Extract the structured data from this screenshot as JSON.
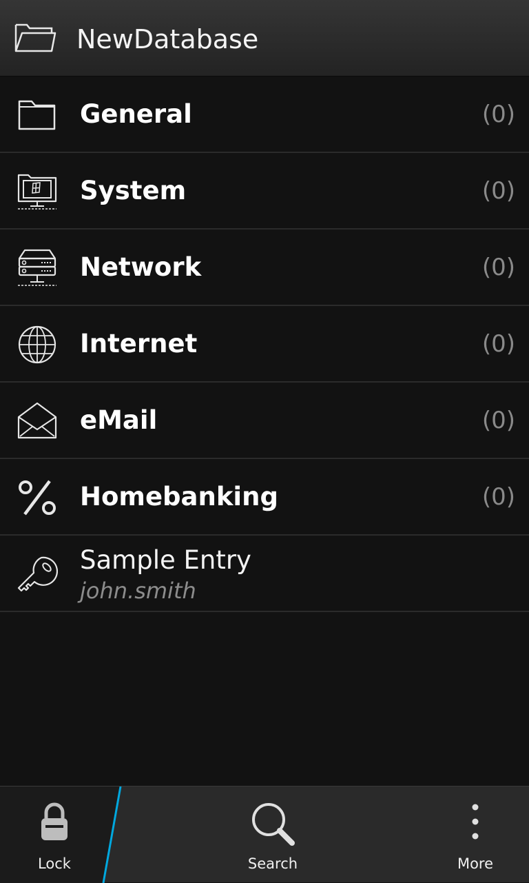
{
  "header": {
    "title": "NewDatabase",
    "icon": "folder-open-icon"
  },
  "groups": [
    {
      "label": "General",
      "count": "(0)",
      "icon": "folder-icon"
    },
    {
      "label": "System",
      "count": "(0)",
      "icon": "computer-icon"
    },
    {
      "label": "Network",
      "count": "(0)",
      "icon": "server-icon"
    },
    {
      "label": "Internet",
      "count": "(0)",
      "icon": "globe-icon"
    },
    {
      "label": "eMail",
      "count": "(0)",
      "icon": "envelope-icon"
    },
    {
      "label": "Homebanking",
      "count": "(0)",
      "icon": "percent-icon"
    }
  ],
  "entries": [
    {
      "title": "Sample Entry",
      "username": "john.smith",
      "icon": "key-icon"
    }
  ],
  "actionbar": {
    "lock_label": "Lock",
    "search_label": "Search",
    "more_label": "More",
    "accent_color": "#00a8df"
  }
}
